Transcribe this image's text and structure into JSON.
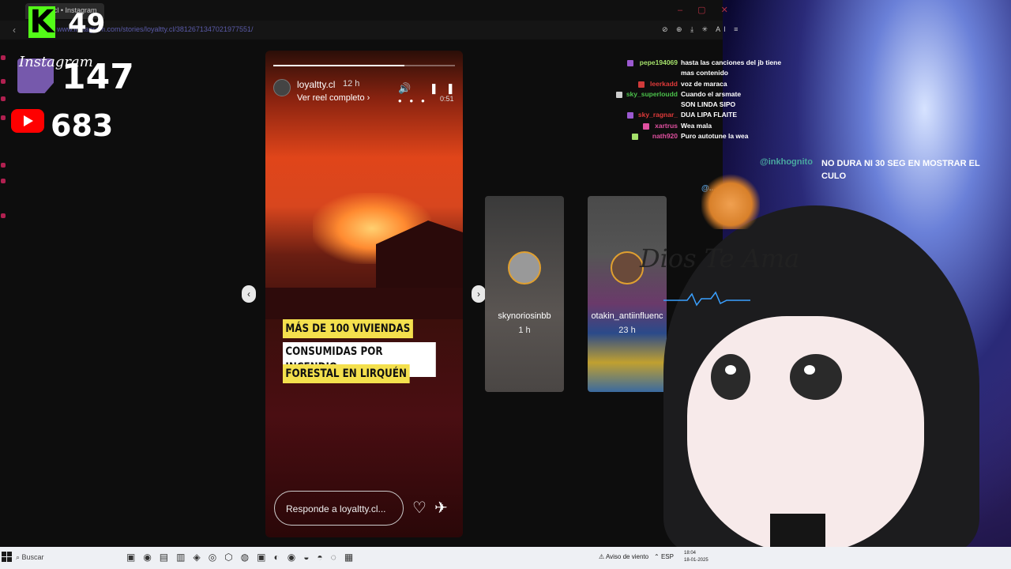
{
  "browser": {
    "tab_title": "loyaltty.cl • Instagram",
    "url": "www.instagram.com/stories/loyaltty.cl/3812671347021977551/",
    "window_controls": "– ▢ ✕",
    "ext_icons": "⊘ ⊕ ⤓ ✳ AI ≡"
  },
  "overlay": {
    "kick_badge": "K",
    "kick_count": "49",
    "instagram_label": "Instagram",
    "twitch_count": "147",
    "youtube_count": "683"
  },
  "story": {
    "username": "loyaltty.cl",
    "time_ago": "12 h",
    "reel_link": "Ver reel completo ›",
    "duration": "0:51",
    "controls": "🔊 ❚❚ •••",
    "progress_fraction": 0.72,
    "headline_1": "MÁS DE 100 VIVIENDAS",
    "headline_2": "CONSUMIDAS POR INCENDIO",
    "headline_3": "FORESTAL EN LIRQUÉN",
    "reply_placeholder": "Responde a loyaltty.cl...",
    "heart_icon": "♡",
    "send_icon": "✈",
    "prev_arrow": "‹",
    "next_arrow": "›"
  },
  "previews": [
    {
      "name": "skynoriosinbb",
      "time": "1 h"
    },
    {
      "name": "otakin_antiinfluenc",
      "time": "23 h"
    }
  ],
  "chat": [
    {
      "user": "pepe194069",
      "msg": "hasta las canciones del jb tiene",
      "user_color": "#a4e06a",
      "badge_color": "#9b59d0"
    },
    {
      "user": "",
      "msg": "mas contenido",
      "user_color": "#a4e06a",
      "badge_color": ""
    },
    {
      "user": "leerkadd",
      "msg": "voz de maraca",
      "user_color": "#e03a3a",
      "badge_color": "#d03a3a"
    },
    {
      "user": "sky_superloudd",
      "msg": "Cuando el arsmate",
      "user_color": "#4ac04a",
      "badge_color": "#cccccc"
    },
    {
      "user": "",
      "msg": "SON LINDA SIPO",
      "user_color": "#3a5ad8",
      "badge_color": ""
    },
    {
      "user": "sky_ragnar_",
      "msg": "DUA LIPA FLAITE",
      "user_color": "#e03a3a",
      "badge_color": "#9b59d0"
    },
    {
      "user": "xartrus",
      "msg": "Wea mala",
      "user_color": "#e050a0",
      "badge_color": "#e050a0"
    },
    {
      "user": "nath920",
      "msg": "Puro autotune la wea",
      "user_color": "#e050a0",
      "badge_color": "#a4e06a"
    }
  ],
  "mention": {
    "user": "@inkhognito",
    "text": "NO DURA NI 30 SEG EN MOSTRAR EL CULO",
    "user2": "@..."
  },
  "vtuber": {
    "scribble": "Dios Te Ama"
  },
  "taskbar": {
    "search_label": "Buscar",
    "weather": "Aviso de viento",
    "lang": "ESP",
    "time": "18:04",
    "date": "18-01-2025"
  }
}
